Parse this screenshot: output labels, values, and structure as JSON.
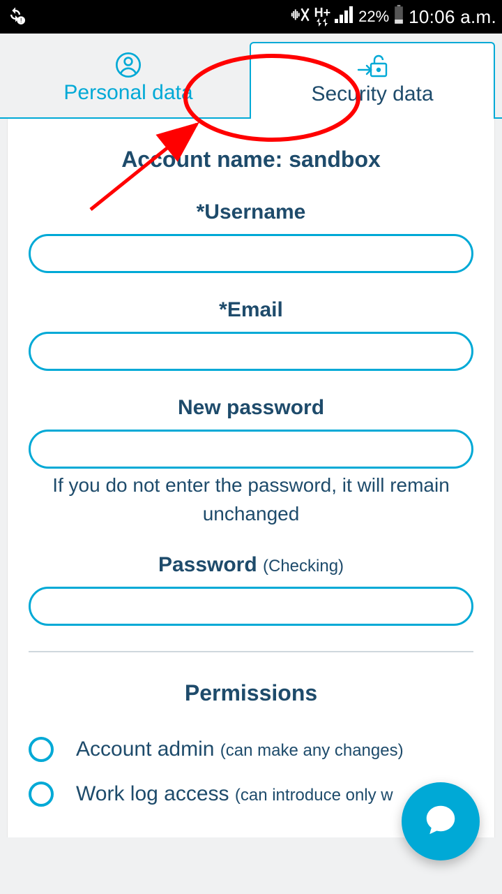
{
  "status": {
    "battery_pct": "22%",
    "time": "10:06 a.m."
  },
  "tabs": {
    "personal": "Personal data",
    "security": "Security data"
  },
  "account": {
    "label": "Account name: sandbox"
  },
  "fields": {
    "username_label": "*Username",
    "email_label": "*Email",
    "newpassword_label": "New password",
    "newpassword_help": "If you do not enter the password, it will remain unchanged",
    "passwordcheck_label": "Password ",
    "passwordcheck_sub": "(Checking)"
  },
  "permissions": {
    "title": "Permissions",
    "items": [
      {
        "label": "Account admin ",
        "sub": "(can make any changes)"
      },
      {
        "label": "Work log access ",
        "sub": "(can introduce only w"
      }
    ]
  }
}
